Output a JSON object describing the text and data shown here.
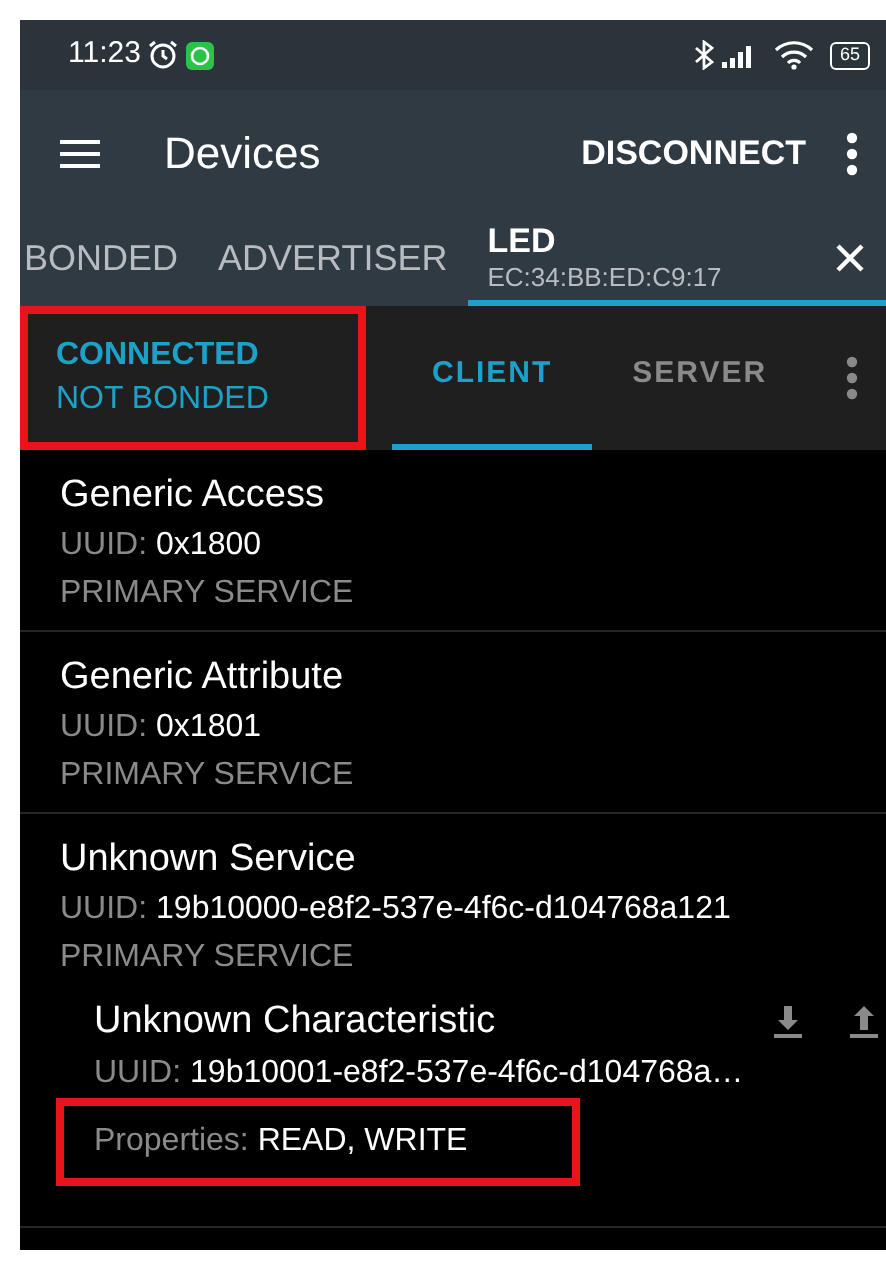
{
  "status_bar": {
    "time": "11:23",
    "battery": "65"
  },
  "app_bar": {
    "title": "Devices",
    "action": "DISCONNECT"
  },
  "device_tabs": [
    {
      "label": "BONDED",
      "selected": false
    },
    {
      "label": "ADVERTISER",
      "selected": false
    },
    {
      "label": "LED",
      "address": "EC:34:BB:ED:C9:17",
      "selected": true,
      "closable": true
    }
  ],
  "connection": {
    "state": "CONNECTED",
    "bond": "NOT BONDED",
    "highlighted": true
  },
  "role_tabs": [
    {
      "label": "CLIENT",
      "selected": true
    },
    {
      "label": "SERVER",
      "selected": false
    }
  ],
  "services": [
    {
      "name": "Generic Access",
      "uuid_label": "UUID:",
      "uuid": "0x1800",
      "type": "PRIMARY SERVICE"
    },
    {
      "name": "Generic Attribute",
      "uuid_label": "UUID:",
      "uuid": "0x1801",
      "type": "PRIMARY SERVICE"
    },
    {
      "name": "Unknown Service",
      "uuid_label": "UUID:",
      "uuid": "19b10000-e8f2-537e-4f6c-d104768a121",
      "type": "PRIMARY SERVICE",
      "characteristics": [
        {
          "name": "Unknown Characteristic",
          "uuid_label": "UUID:",
          "uuid": "19b10001-e8f2-537e-4f6c-d104768a…",
          "properties_label": "Properties:",
          "properties": "READ, WRITE",
          "highlighted": true
        }
      ]
    }
  ]
}
